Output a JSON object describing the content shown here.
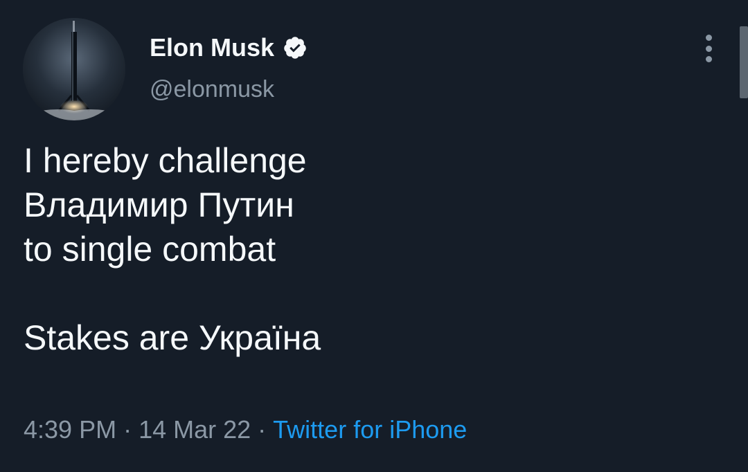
{
  "author": {
    "display_name": "Elon Musk",
    "handle": "@elonmusk",
    "verified": true,
    "avatar_icon": "rocket-booster-avatar"
  },
  "tweet": {
    "lines": [
      "I hereby challenge",
      "Владимир Путин",
      "to single combat",
      "",
      "Stakes are Україна"
    ]
  },
  "meta": {
    "time": "4:39 PM",
    "separator": "·",
    "date": "14 Mar 22",
    "source": "Twitter for iPhone"
  },
  "colors": {
    "background": "#151d28",
    "text_primary": "#f5f8fa",
    "text_secondary": "#8b98a5",
    "link": "#1d9bf0"
  },
  "icons": {
    "verified": "verified-badge-icon",
    "more": "more-vertical-icon"
  }
}
